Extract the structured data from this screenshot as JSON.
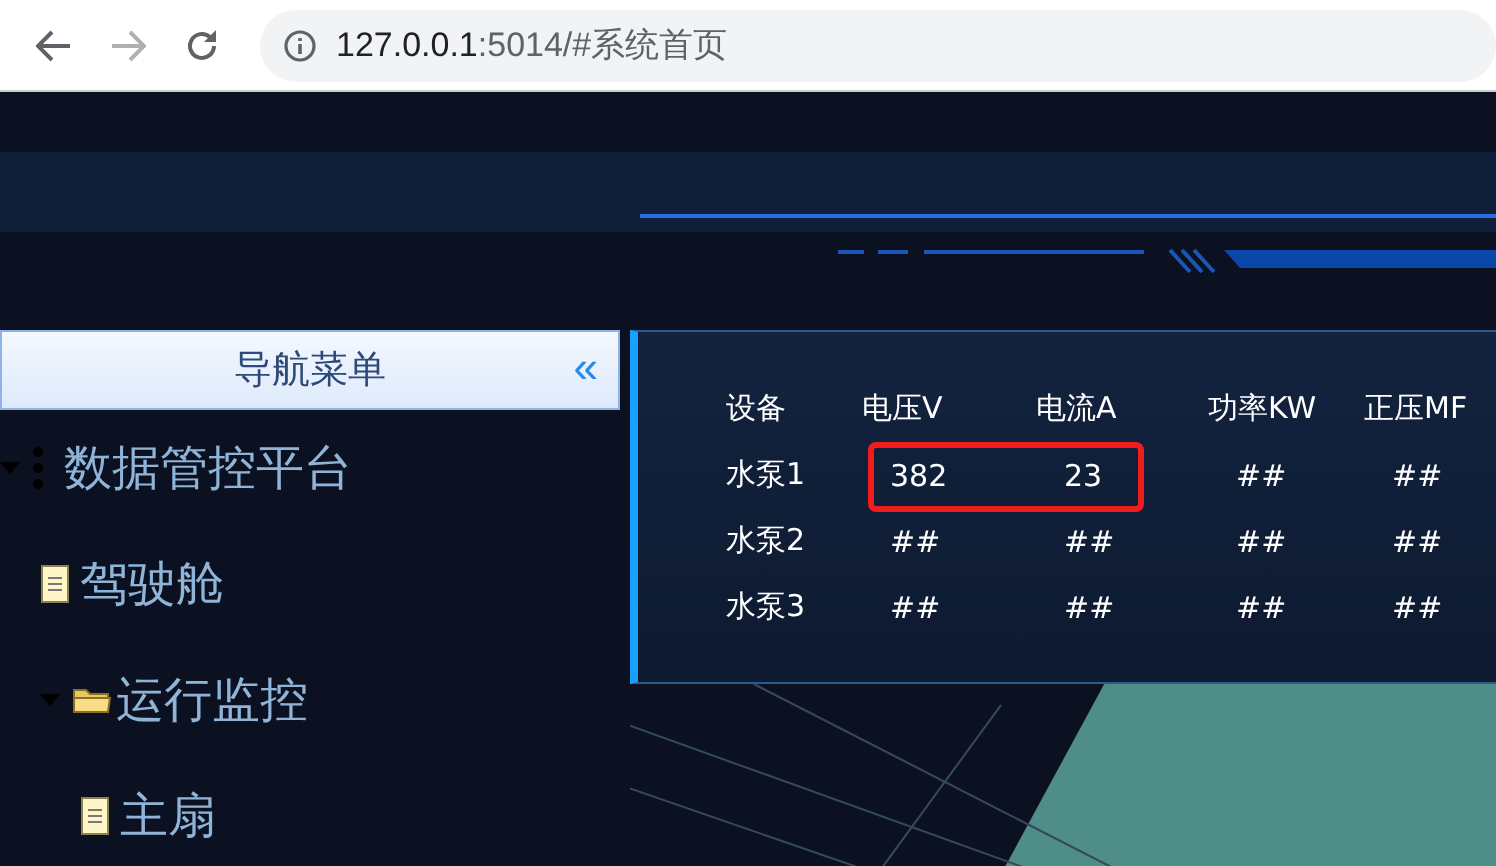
{
  "browser": {
    "back_disabled": false,
    "forward_disabled": true,
    "address_host": "127.0.0.1",
    "address_rest": ":5014/#系统首页"
  },
  "sidebar": {
    "title": "导航菜单",
    "collapse_glyph": "«",
    "tree": [
      {
        "label": "数据管控平台",
        "expanded": true,
        "children": [
          {
            "label": "驾驶舱"
          },
          {
            "label": "运行监控",
            "expanded": true,
            "children": [
              {
                "label": "主扇"
              }
            ]
          }
        ]
      }
    ]
  },
  "table": {
    "columns": [
      "设备",
      "电压V",
      "电流A",
      "功率KW",
      "正压MF"
    ],
    "rows": [
      [
        "水泵1",
        "382",
        "23",
        "##",
        "##"
      ],
      [
        "水泵2",
        "##",
        "##",
        "##",
        "##"
      ],
      [
        "水泵3",
        "##",
        "##",
        "##",
        "##"
      ]
    ]
  }
}
